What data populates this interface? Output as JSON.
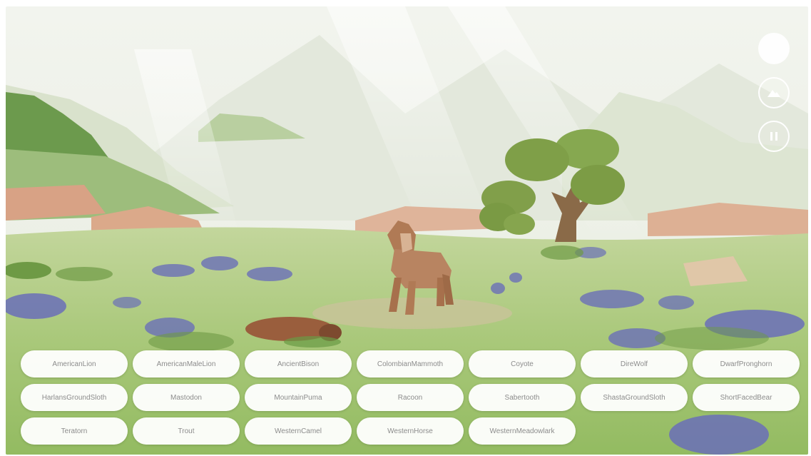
{
  "scene": {
    "sky_color": "#eef1e8",
    "grass_color": "#a9c87a",
    "flower_color": "#6a6fb8",
    "tree_color": "#7fa048",
    "rock_color": "#d6a98a",
    "lion_color": "#b07a55"
  },
  "controls": [
    {
      "name": "home-icon",
      "icon": "filled-circle"
    },
    {
      "name": "terrain-icon",
      "icon": "mountain"
    },
    {
      "name": "pause-icon",
      "icon": "pause"
    }
  ],
  "animals": [
    {
      "label": "AmericanLion"
    },
    {
      "label": "AmericanMaleLion"
    },
    {
      "label": "AncientBison"
    },
    {
      "label": "ColombianMammoth"
    },
    {
      "label": "Coyote"
    },
    {
      "label": "DireWolf"
    },
    {
      "label": "DwarfPronghorn"
    },
    {
      "label": "HarlansGroundSloth"
    },
    {
      "label": "Mastodon"
    },
    {
      "label": "MountainPuma"
    },
    {
      "label": "Racoon"
    },
    {
      "label": "Sabertooth"
    },
    {
      "label": "ShastaGroundSloth"
    },
    {
      "label": "ShortFacedBear"
    },
    {
      "label": "Teratorn"
    },
    {
      "label": "Trout"
    },
    {
      "label": "WesternCamel"
    },
    {
      "label": "WesternHorse"
    },
    {
      "label": "WesternMeadowlark"
    }
  ]
}
